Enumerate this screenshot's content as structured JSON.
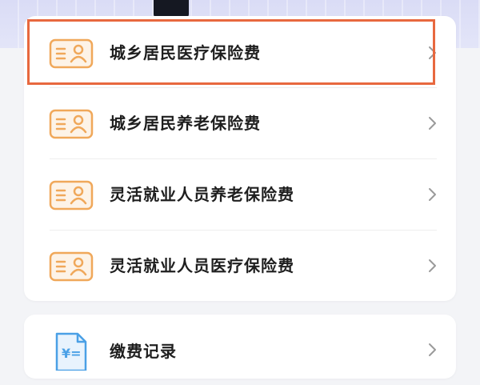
{
  "menu": {
    "items": [
      {
        "label": "城乡居民医疗保险费",
        "icon": "id-card-icon"
      },
      {
        "label": "城乡居民养老保险费",
        "icon": "id-card-icon"
      },
      {
        "label": "灵活就业人员养老保险费",
        "icon": "id-card-icon"
      },
      {
        "label": "灵活就业人员医疗保险费",
        "icon": "id-card-icon"
      }
    ]
  },
  "records": {
    "label": "缴费记录",
    "icon": "receipt-icon",
    "icon_text": "¥="
  },
  "colors": {
    "accent_orange": "#e8683f",
    "icon_orange": "#f0a85a",
    "icon_blue": "#4aa0e6",
    "background": "#f3f4f7"
  }
}
